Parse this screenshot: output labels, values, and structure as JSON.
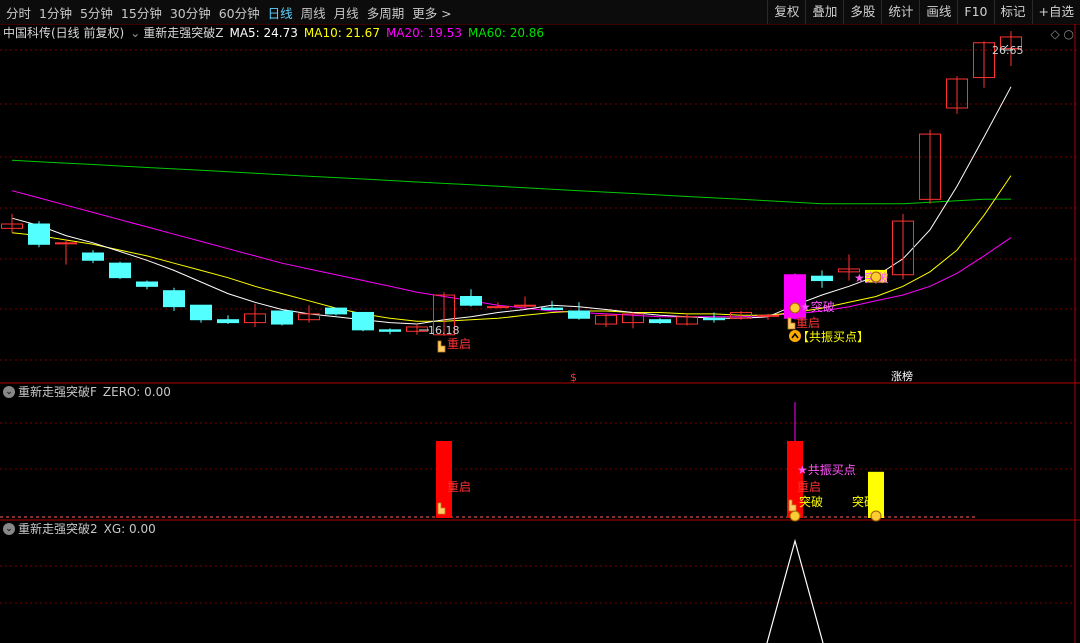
{
  "toolbar": {
    "periods": [
      "分时",
      "1分钟",
      "5分钟",
      "15分钟",
      "30分钟",
      "60分钟",
      "日线",
      "周线",
      "月线",
      "多周期",
      "更多 >"
    ],
    "active_period": "日线",
    "right_buttons": [
      "复权",
      "叠加",
      "多股",
      "统计",
      "画线",
      "F10",
      "标记",
      "+自选"
    ]
  },
  "main_info": {
    "stock": "中国科传(日线 前复权)",
    "formula": "重新走强突破Z",
    "ma5": "MA5: 24.73",
    "ma10": "MA10: 21.67",
    "ma20": "MA20: 19.53",
    "ma60": "MA60: 20.86"
  },
  "main_labels": {
    "high_price": "26.65",
    "low_price": "16.18",
    "restart_1": "重启",
    "restart_2": "重启",
    "breakout_1": "★突破",
    "breakout_2": "★突破",
    "resonance_buy": "【共振买点】",
    "dollar_mark": "$",
    "limit_up": "涨榜"
  },
  "panel2": {
    "title_name": "重新走强突破F",
    "title_value": "ZERO: 0.00",
    "labels": {
      "restart_1": "重启",
      "restart_2": "重启",
      "resonance": "★共振买点",
      "breakout_1": "突破",
      "breakout_2": "突破"
    }
  },
  "panel3": {
    "title_name": "重新走强突破2",
    "title_value": "XG: 0.00"
  },
  "colors": {
    "up": "#ff3232",
    "down": "#54ffff",
    "ma5": "#ffffff",
    "ma10": "#ffff00",
    "ma20": "#ff00ff",
    "ma60": "#00c800",
    "grid": "#7a0000"
  },
  "chart_data": {
    "type": "candlestick",
    "candles": [
      {
        "o": 19.85,
        "h": 20.35,
        "l": 19.7,
        "c": 20.0
      },
      {
        "o": 20.0,
        "h": 20.1,
        "l": 19.2,
        "c": 19.3
      },
      {
        "o": 19.35,
        "h": 19.45,
        "l": 18.6,
        "c": 19.35
      },
      {
        "o": 19.0,
        "h": 19.1,
        "l": 18.65,
        "c": 18.75
      },
      {
        "o": 18.65,
        "h": 18.7,
        "l": 18.1,
        "c": 18.15
      },
      {
        "o": 18.0,
        "h": 18.05,
        "l": 17.75,
        "c": 17.85
      },
      {
        "o": 17.7,
        "h": 17.8,
        "l": 17.0,
        "c": 17.15
      },
      {
        "o": 17.2,
        "h": 17.2,
        "l": 16.6,
        "c": 16.7
      },
      {
        "o": 16.7,
        "h": 16.85,
        "l": 16.55,
        "c": 16.6
      },
      {
        "o": 16.6,
        "h": 17.25,
        "l": 16.45,
        "c": 16.9
      },
      {
        "o": 17.0,
        "h": 17.0,
        "l": 16.5,
        "c": 16.55
      },
      {
        "o": 16.7,
        "h": 17.2,
        "l": 16.6,
        "c": 16.9
      },
      {
        "o": 17.1,
        "h": 17.1,
        "l": 16.85,
        "c": 16.9
      },
      {
        "o": 16.95,
        "h": 16.95,
        "l": 16.3,
        "c": 16.35
      },
      {
        "o": 16.35,
        "h": 16.4,
        "l": 16.2,
        "c": 16.3
      },
      {
        "o": 16.3,
        "h": 16.55,
        "l": 16.18,
        "c": 16.45
      },
      {
        "o": 16.18,
        "h": 17.65,
        "l": 16.15,
        "c": 17.55
      },
      {
        "o": 17.5,
        "h": 17.75,
        "l": 17.15,
        "c": 17.2
      },
      {
        "o": 17.15,
        "h": 17.3,
        "l": 17.1,
        "c": 17.15
      },
      {
        "o": 17.2,
        "h": 17.5,
        "l": 17.1,
        "c": 17.2
      },
      {
        "o": 17.1,
        "h": 17.35,
        "l": 17.05,
        "c": 17.05
      },
      {
        "o": 17.0,
        "h": 17.3,
        "l": 16.7,
        "c": 16.75
      },
      {
        "o": 16.55,
        "h": 16.9,
        "l": 16.45,
        "c": 16.85
      },
      {
        "o": 16.6,
        "h": 16.95,
        "l": 16.4,
        "c": 16.9
      },
      {
        "o": 16.7,
        "h": 16.75,
        "l": 16.55,
        "c": 16.6
      },
      {
        "o": 16.55,
        "h": 16.9,
        "l": 16.5,
        "c": 16.8
      },
      {
        "o": 16.75,
        "h": 16.95,
        "l": 16.6,
        "c": 16.7
      },
      {
        "o": 16.75,
        "h": 17.0,
        "l": 16.7,
        "c": 16.95
      },
      {
        "o": 16.85,
        "h": 16.9,
        "l": 16.7,
        "c": 16.85
      },
      {
        "o": 16.75,
        "h": 18.3,
        "l": 16.7,
        "c": 18.25
      },
      {
        "o": 18.2,
        "h": 18.4,
        "l": 17.8,
        "c": 18.05
      },
      {
        "o": 18.35,
        "h": 18.95,
        "l": 18.05,
        "c": 18.45
      },
      {
        "o": 18.0,
        "h": 18.4,
        "l": 17.95,
        "c": 18.4
      },
      {
        "o": 18.25,
        "h": 20.35,
        "l": 18.1,
        "c": 20.1
      },
      {
        "o": 20.85,
        "h": 23.25,
        "l": 20.7,
        "c": 23.1
      },
      {
        "o": 24.0,
        "h": 25.1,
        "l": 23.8,
        "c": 25.0
      },
      {
        "o": 25.05,
        "h": 26.3,
        "l": 24.7,
        "c": 26.25
      },
      {
        "o": 26.05,
        "h": 26.65,
        "l": 25.45,
        "c": 26.45
      }
    ],
    "special_candles": {
      "16": "up",
      "29": "magenta",
      "32": "yellow"
    },
    "ma5": [
      20.2,
      19.95,
      19.6,
      19.35,
      19.05,
      18.75,
      18.4,
      18.0,
      17.6,
      17.3,
      17.05,
      16.9,
      16.8,
      16.7,
      16.6,
      16.55,
      16.7,
      16.8,
      16.95,
      17.05,
      17.2,
      17.15,
      17.05,
      16.95,
      16.85,
      16.8,
      16.75,
      16.75,
      16.8,
      17.2,
      17.55,
      17.85,
      18.2,
      18.8,
      19.8,
      21.3,
      23.0,
      24.73
    ],
    "ma10": [
      19.7,
      19.6,
      19.45,
      19.3,
      19.1,
      18.9,
      18.65,
      18.4,
      18.15,
      17.85,
      17.6,
      17.35,
      17.1,
      16.9,
      16.75,
      16.65,
      16.65,
      16.7,
      16.75,
      16.85,
      16.95,
      17.0,
      17.0,
      16.95,
      16.95,
      16.9,
      16.9,
      16.85,
      16.85,
      16.95,
      17.1,
      17.3,
      17.5,
      17.85,
      18.35,
      19.1,
      20.3,
      21.67
    ],
    "ma20": [
      21.15,
      20.9,
      20.65,
      20.4,
      20.15,
      19.9,
      19.65,
      19.4,
      19.15,
      18.9,
      18.65,
      18.45,
      18.25,
      18.05,
      17.85,
      17.65,
      17.5,
      17.35,
      17.2,
      17.1,
      17.0,
      16.95,
      16.9,
      16.85,
      16.8,
      16.8,
      16.8,
      16.8,
      16.85,
      16.9,
      17.0,
      17.15,
      17.35,
      17.55,
      17.85,
      18.3,
      18.9,
      19.53
    ],
    "ma60": [
      22.2,
      22.15,
      22.1,
      22.05,
      22.0,
      21.95,
      21.9,
      21.85,
      21.8,
      21.75,
      21.7,
      21.65,
      21.6,
      21.55,
      21.5,
      21.45,
      21.4,
      21.35,
      21.3,
      21.25,
      21.2,
      21.15,
      21.1,
      21.05,
      21.0,
      20.95,
      20.9,
      20.85,
      20.8,
      20.75,
      20.7,
      20.7,
      20.7,
      20.7,
      20.75,
      20.8,
      20.85,
      20.86
    ],
    "panel2_bars": [
      {
        "index": 16,
        "value": 1,
        "color": "red"
      },
      {
        "index": 29,
        "value": 1,
        "color": "red"
      },
      {
        "index": 32,
        "value": 0.6,
        "color": "yellow"
      }
    ],
    "panel3_signal": {
      "index": 29,
      "value": 1
    }
  }
}
